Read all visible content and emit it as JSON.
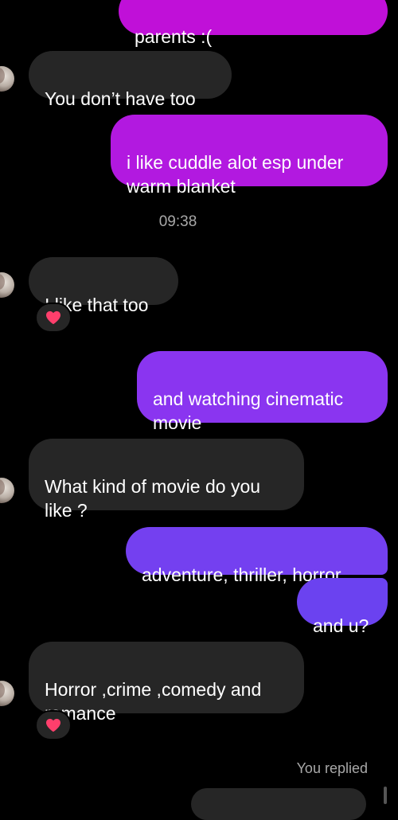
{
  "colors": {
    "background": "#000000",
    "incoming_bubble": "#262626",
    "outgoing_pink": "#c010d8",
    "outgoing_purple": "#9a2cf0",
    "outgoing_violet": "#6f3ef0",
    "timestamp_text": "#a8a8a8",
    "reaction_heart": "#ff3f6c"
  },
  "messages": [
    {
      "sender": "me",
      "text": "parents :("
    },
    {
      "sender": "them",
      "text": "You don’t have too"
    },
    {
      "sender": "me",
      "text": "i like cuddle alot esp under\nwarm blanket"
    },
    {
      "sender": "them",
      "text": "I like that too",
      "reaction": "heart-icon"
    },
    {
      "sender": "me",
      "text": "and watching cinematic\nmovie"
    },
    {
      "sender": "them",
      "text": "What kind of movie do you\nlike ?"
    },
    {
      "sender": "me",
      "text": "adventure, thriller, horror"
    },
    {
      "sender": "me",
      "text": "and u?"
    },
    {
      "sender": "them",
      "text": "Horror ,crime ,comedy and\nromance",
      "reaction": "heart-icon"
    }
  ],
  "timestamp": "09:38",
  "reply_status": "You replied"
}
